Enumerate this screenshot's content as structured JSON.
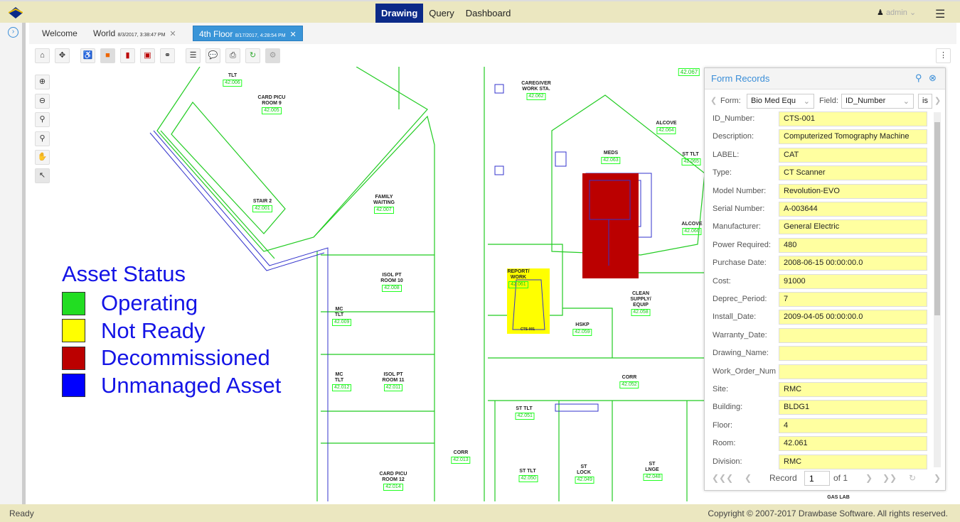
{
  "app": {
    "nav": [
      "Drawing",
      "Query",
      "Dashboard"
    ],
    "active_nav": "Drawing",
    "user": "admin"
  },
  "tabs": [
    {
      "label": "Welcome"
    },
    {
      "label": "World",
      "date": "8/3/2017, 3:38:47 PM"
    },
    {
      "label": "4th Floor",
      "date": "8/17/2017, 4:28:54 PM",
      "active": true
    }
  ],
  "toolbar": [
    "home-icon",
    "zoom-extents-icon",
    "wheelchair-icon",
    "occupancy-icon",
    "thermometer-icon",
    "factory-icon",
    "link-icon",
    "layers-icon",
    "chat-icon",
    "print-icon",
    "refresh-icon",
    "settings-icon"
  ],
  "side_tools": [
    "zoom-in-icon",
    "zoom-out-icon",
    "zoom-window-icon",
    "zoom-previous-icon",
    "pan-hand-icon",
    "select-pointer-icon"
  ],
  "legend": {
    "title": "Asset Status",
    "items": [
      {
        "label": "Operating",
        "color": "#22dd22"
      },
      {
        "label": "Not Ready",
        "color": "#ffff00"
      },
      {
        "label": "Decommissioned",
        "color": "#bb0000"
      },
      {
        "label": "Unmanaged Asset",
        "color": "#0000ff"
      }
    ]
  },
  "rooms": [
    {
      "name": "TLT",
      "num": "42.006"
    },
    {
      "name": "CARD PICU ROOM 9",
      "num": "42.005"
    },
    {
      "name": "STAIR 2",
      "num": "42.001"
    },
    {
      "name": "FAMILY WAITING",
      "num": "42.007"
    },
    {
      "name": "CAREGIVER WORK STA.",
      "num": "42.062"
    },
    {
      "name": "MEDS",
      "num": "42.063"
    },
    {
      "name": "ALCOVE",
      "num": "42.064"
    },
    {
      "name": "ST TLT",
      "num": "42.065"
    },
    {
      "name": "ALCOVE",
      "num": "42.066"
    },
    {
      "name": "ISOL PT ROOM 10",
      "num": "42.008"
    },
    {
      "name": "MC TLT",
      "num": "42.009"
    },
    {
      "name": "REPORT/ WORK",
      "num": "42.061"
    },
    {
      "name": "CLEAN SUPPLY/ EQUIP",
      "num": "42.058"
    },
    {
      "name": "HSKP",
      "num": "42.059"
    },
    {
      "name": "MC TLT",
      "num": "42.012"
    },
    {
      "name": "ISOL PT ROOM 11",
      "num": "42.011"
    },
    {
      "name": "CORR",
      "num": "42.052"
    },
    {
      "name": "ST TLT",
      "num": "42.051"
    },
    {
      "name": "CORR",
      "num": "42.013"
    },
    {
      "name": "CARD PICU ROOM 12",
      "num": "42.014"
    },
    {
      "name": "ST TLT",
      "num": "42.050"
    },
    {
      "name": "ST LOCK",
      "num": "42.049"
    },
    {
      "name": "ST LNGE",
      "num": "42.048"
    },
    {
      "name": "GAS LAB",
      "num": ""
    },
    {
      "name": "",
      "num": "42.067"
    }
  ],
  "asset_label": "CTS-001",
  "panel": {
    "title": "Form Records",
    "form_label": "Form:",
    "form_value": "Bio Med Equ",
    "field_label": "Field:",
    "field_value": "ID_Number",
    "op_value": "is",
    "fields": [
      {
        "label": "ID_Number:",
        "value": "CTS-001"
      },
      {
        "label": "Description:",
        "value": "Computerized Tomography Machine"
      },
      {
        "label": "LABEL:",
        "value": "CAT"
      },
      {
        "label": "Type:",
        "value": "CT Scanner"
      },
      {
        "label": "Model Number:",
        "value": "Revolution-EVO"
      },
      {
        "label": "Serial Number:",
        "value": "A-003644"
      },
      {
        "label": "Manufacturer:",
        "value": "General Electric"
      },
      {
        "label": "Power Required:",
        "value": "480"
      },
      {
        "label": "Purchase Date:",
        "value": "2008-06-15 00:00:00.0"
      },
      {
        "label": "Cost:",
        "value": "91000"
      },
      {
        "label": "Deprec_Period:",
        "value": "7"
      },
      {
        "label": "Install_Date:",
        "value": "2009-04-05 00:00:00.0"
      },
      {
        "label": "Warranty_Date:",
        "value": ""
      },
      {
        "label": "Drawing_Name:",
        "value": ""
      },
      {
        "label": "Work_Order_Num",
        "value": ""
      },
      {
        "label": "Site:",
        "value": "RMC"
      },
      {
        "label": "Building:",
        "value": "BLDG1"
      },
      {
        "label": "Floor:",
        "value": "4"
      },
      {
        "label": "Room:",
        "value": "42.061"
      },
      {
        "label": "Division:",
        "value": "RMC"
      }
    ],
    "pager": {
      "record_label": "Record",
      "record": "1",
      "of": "of 1"
    }
  },
  "footer": {
    "status": "Ready",
    "copyright": "Copyright © 2007-2017 Drawbase Software. All rights reserved."
  }
}
